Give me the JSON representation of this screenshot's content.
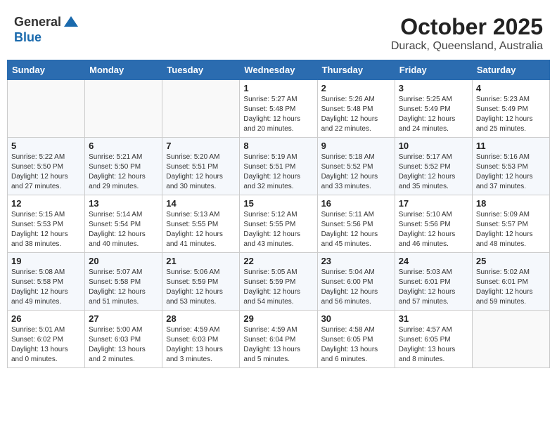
{
  "header": {
    "logo_general": "General",
    "logo_blue": "Blue",
    "month": "October 2025",
    "location": "Durack, Queensland, Australia"
  },
  "weekdays": [
    "Sunday",
    "Monday",
    "Tuesday",
    "Wednesday",
    "Thursday",
    "Friday",
    "Saturday"
  ],
  "weeks": [
    [
      {
        "day": "",
        "info": ""
      },
      {
        "day": "",
        "info": ""
      },
      {
        "day": "",
        "info": ""
      },
      {
        "day": "1",
        "info": "Sunrise: 5:27 AM\nSunset: 5:48 PM\nDaylight: 12 hours\nand 20 minutes."
      },
      {
        "day": "2",
        "info": "Sunrise: 5:26 AM\nSunset: 5:48 PM\nDaylight: 12 hours\nand 22 minutes."
      },
      {
        "day": "3",
        "info": "Sunrise: 5:25 AM\nSunset: 5:49 PM\nDaylight: 12 hours\nand 24 minutes."
      },
      {
        "day": "4",
        "info": "Sunrise: 5:23 AM\nSunset: 5:49 PM\nDaylight: 12 hours\nand 25 minutes."
      }
    ],
    [
      {
        "day": "5",
        "info": "Sunrise: 5:22 AM\nSunset: 5:50 PM\nDaylight: 12 hours\nand 27 minutes."
      },
      {
        "day": "6",
        "info": "Sunrise: 5:21 AM\nSunset: 5:50 PM\nDaylight: 12 hours\nand 29 minutes."
      },
      {
        "day": "7",
        "info": "Sunrise: 5:20 AM\nSunset: 5:51 PM\nDaylight: 12 hours\nand 30 minutes."
      },
      {
        "day": "8",
        "info": "Sunrise: 5:19 AM\nSunset: 5:51 PM\nDaylight: 12 hours\nand 32 minutes."
      },
      {
        "day": "9",
        "info": "Sunrise: 5:18 AM\nSunset: 5:52 PM\nDaylight: 12 hours\nand 33 minutes."
      },
      {
        "day": "10",
        "info": "Sunrise: 5:17 AM\nSunset: 5:52 PM\nDaylight: 12 hours\nand 35 minutes."
      },
      {
        "day": "11",
        "info": "Sunrise: 5:16 AM\nSunset: 5:53 PM\nDaylight: 12 hours\nand 37 minutes."
      }
    ],
    [
      {
        "day": "12",
        "info": "Sunrise: 5:15 AM\nSunset: 5:53 PM\nDaylight: 12 hours\nand 38 minutes."
      },
      {
        "day": "13",
        "info": "Sunrise: 5:14 AM\nSunset: 5:54 PM\nDaylight: 12 hours\nand 40 minutes."
      },
      {
        "day": "14",
        "info": "Sunrise: 5:13 AM\nSunset: 5:55 PM\nDaylight: 12 hours\nand 41 minutes."
      },
      {
        "day": "15",
        "info": "Sunrise: 5:12 AM\nSunset: 5:55 PM\nDaylight: 12 hours\nand 43 minutes."
      },
      {
        "day": "16",
        "info": "Sunrise: 5:11 AM\nSunset: 5:56 PM\nDaylight: 12 hours\nand 45 minutes."
      },
      {
        "day": "17",
        "info": "Sunrise: 5:10 AM\nSunset: 5:56 PM\nDaylight: 12 hours\nand 46 minutes."
      },
      {
        "day": "18",
        "info": "Sunrise: 5:09 AM\nSunset: 5:57 PM\nDaylight: 12 hours\nand 48 minutes."
      }
    ],
    [
      {
        "day": "19",
        "info": "Sunrise: 5:08 AM\nSunset: 5:58 PM\nDaylight: 12 hours\nand 49 minutes."
      },
      {
        "day": "20",
        "info": "Sunrise: 5:07 AM\nSunset: 5:58 PM\nDaylight: 12 hours\nand 51 minutes."
      },
      {
        "day": "21",
        "info": "Sunrise: 5:06 AM\nSunset: 5:59 PM\nDaylight: 12 hours\nand 53 minutes."
      },
      {
        "day": "22",
        "info": "Sunrise: 5:05 AM\nSunset: 5:59 PM\nDaylight: 12 hours\nand 54 minutes."
      },
      {
        "day": "23",
        "info": "Sunrise: 5:04 AM\nSunset: 6:00 PM\nDaylight: 12 hours\nand 56 minutes."
      },
      {
        "day": "24",
        "info": "Sunrise: 5:03 AM\nSunset: 6:01 PM\nDaylight: 12 hours\nand 57 minutes."
      },
      {
        "day": "25",
        "info": "Sunrise: 5:02 AM\nSunset: 6:01 PM\nDaylight: 12 hours\nand 59 minutes."
      }
    ],
    [
      {
        "day": "26",
        "info": "Sunrise: 5:01 AM\nSunset: 6:02 PM\nDaylight: 13 hours\nand 0 minutes."
      },
      {
        "day": "27",
        "info": "Sunrise: 5:00 AM\nSunset: 6:03 PM\nDaylight: 13 hours\nand 2 minutes."
      },
      {
        "day": "28",
        "info": "Sunrise: 4:59 AM\nSunset: 6:03 PM\nDaylight: 13 hours\nand 3 minutes."
      },
      {
        "day": "29",
        "info": "Sunrise: 4:59 AM\nSunset: 6:04 PM\nDaylight: 13 hours\nand 5 minutes."
      },
      {
        "day": "30",
        "info": "Sunrise: 4:58 AM\nSunset: 6:05 PM\nDaylight: 13 hours\nand 6 minutes."
      },
      {
        "day": "31",
        "info": "Sunrise: 4:57 AM\nSunset: 6:05 PM\nDaylight: 13 hours\nand 8 minutes."
      },
      {
        "day": "",
        "info": ""
      }
    ]
  ]
}
